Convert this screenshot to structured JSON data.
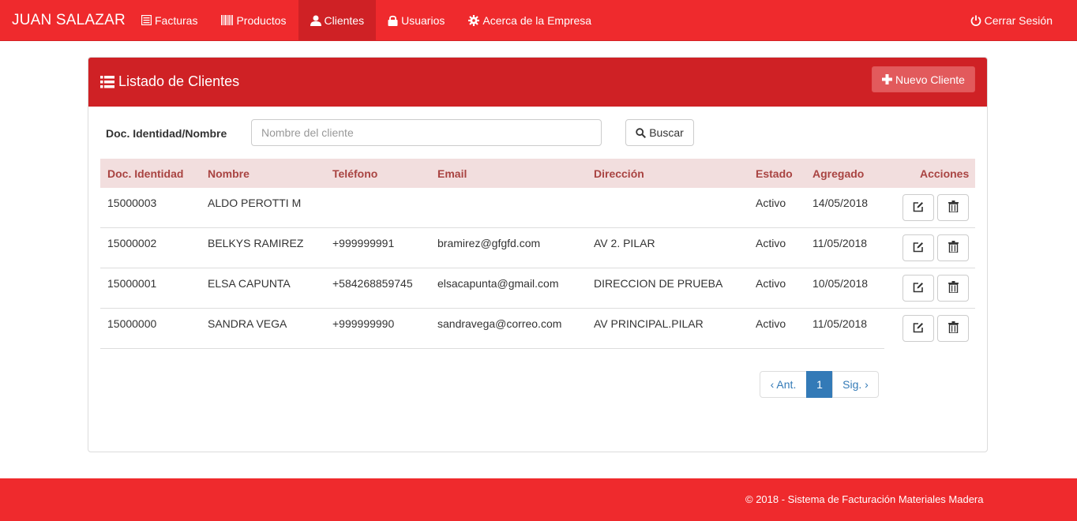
{
  "navbar": {
    "brand": "JUAN SALAZAR",
    "items": [
      {
        "label": "Facturas",
        "icon": "list-alt-icon",
        "active": false
      },
      {
        "label": "Productos",
        "icon": "barcode-icon",
        "active": false
      },
      {
        "label": "Clientes",
        "icon": "user-icon",
        "active": true
      },
      {
        "label": "Usuarios",
        "icon": "lock-icon",
        "active": false
      },
      {
        "label": "Acerca de la Empresa",
        "icon": "gear-icon",
        "active": false
      }
    ],
    "logout": {
      "label": "Cerrar Sesión",
      "icon": "power-icon"
    },
    "color": "#ef2a2d"
  },
  "panel": {
    "title": "Listado de Clientes",
    "title_icon": "list-icon",
    "new_button": "Nuevo Cliente",
    "header_color": "#cf2125"
  },
  "search": {
    "label": "Doc. Identidad/Nombre",
    "placeholder": "Nombre del cliente",
    "value": "",
    "button": "Buscar"
  },
  "table": {
    "columns": [
      "Doc. Identidad",
      "Nombre",
      "Teléfono",
      "Email",
      "Dirección",
      "Estado",
      "Agregado",
      "Acciones"
    ],
    "rows": [
      [
        "15000003",
        "ALDO PEROTTI M",
        "",
        "",
        "",
        "Activo",
        "14/05/2018"
      ],
      [
        "15000002",
        "BELKYS RAMIREZ",
        "+999999991",
        "bramirez@gfgfd.com",
        "AV 2. PILAR",
        "Activo",
        "11/05/2018"
      ],
      [
        "15000001",
        "ELSA CAPUNTA",
        "+584268859745",
        "elsacapunta@gmail.com",
        "DIRECCION DE PRUEBA",
        "Activo",
        "10/05/2018"
      ],
      [
        "15000000",
        "SANDRA VEGA",
        "+999999990",
        "sandravega@correo.com",
        "AV PRINCIPAL.PILAR",
        "Activo",
        "11/05/2018"
      ]
    ],
    "actions": [
      "edit-icon",
      "trash-icon"
    ]
  },
  "pagination": {
    "prev": "‹ Ant.",
    "current": "1",
    "next": "Sig. ›"
  },
  "footer": {
    "text": "© 2018 - Sistema de Facturación Materiales Madera"
  }
}
